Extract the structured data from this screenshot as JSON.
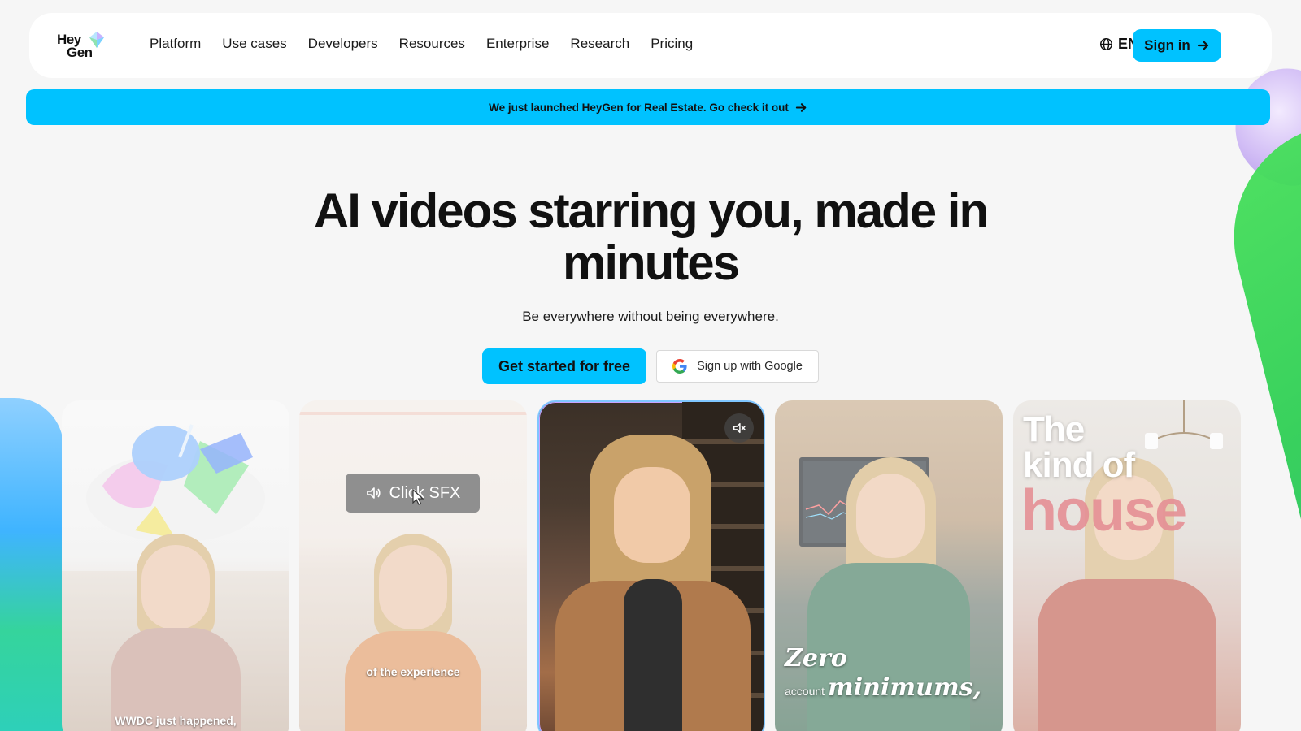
{
  "brand": {
    "logo_line1": "Hey",
    "logo_line2": "Gen"
  },
  "nav": {
    "links": [
      "Platform",
      "Use cases",
      "Developers",
      "Resources",
      "Enterprise",
      "Research",
      "Pricing"
    ],
    "language": "EN",
    "sign_in_label": "Sign in"
  },
  "banner": {
    "text": "We just launched HeyGen for Real Estate. Go check it out"
  },
  "hero": {
    "title": "AI videos starring you, made in minutes",
    "subtitle": "Be everywhere without being everywhere.",
    "cta_primary": "Get started for free",
    "cta_google": "Sign up with Google"
  },
  "cards": {
    "card1": {
      "caption": "WWDC just happened,"
    },
    "card2": {
      "sfx_label": "Click SFX",
      "caption": "of the experience"
    },
    "card3": {
      "mute_icon": "speaker-muted-icon"
    },
    "card4": {
      "word1": "Zero",
      "word2_small": "account",
      "word2_big": "minimums,"
    },
    "card5": {
      "line1": "The",
      "line2": "kind of",
      "line3": "house"
    }
  },
  "colors": {
    "accent": "#00c2ff",
    "background": "#f6f6f6",
    "text": "#111111"
  }
}
